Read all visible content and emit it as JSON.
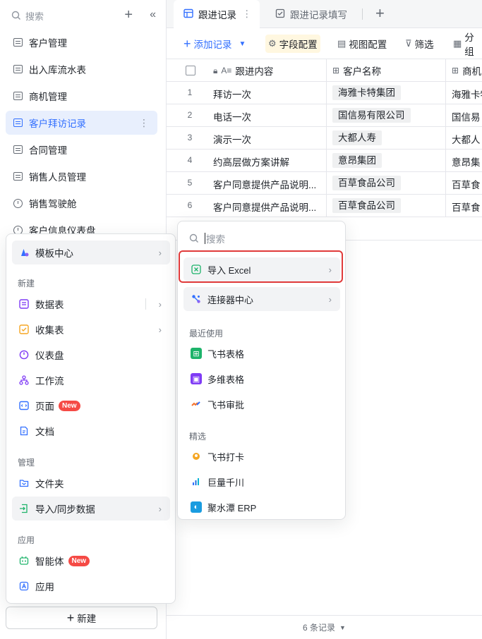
{
  "sidebar": {
    "search_placeholder": "搜索",
    "items": [
      {
        "label": "客户管理",
        "icon": "table-icon"
      },
      {
        "label": "出入库流水表",
        "icon": "table-icon"
      },
      {
        "label": "商机管理",
        "icon": "table-icon"
      },
      {
        "label": "客户拜访记录",
        "icon": "table-icon",
        "active": true
      },
      {
        "label": "合同管理",
        "icon": "table-icon"
      },
      {
        "label": "销售人员管理",
        "icon": "table-icon"
      },
      {
        "label": "销售驾驶舱",
        "icon": "dashboard-icon"
      },
      {
        "label": "客户信息仪表盘",
        "icon": "dashboard-icon"
      }
    ],
    "new_button": "新建"
  },
  "tabs": [
    {
      "label": "跟进记录",
      "active": true
    },
    {
      "label": "跟进记录填写",
      "active": false
    }
  ],
  "toolbar": {
    "add_record": "添加记录",
    "field_config": "字段配置",
    "view_config": "视图配置",
    "filter": "筛选",
    "group": "分组"
  },
  "grid": {
    "columns": [
      "跟进内容",
      "客户名称",
      "商机"
    ],
    "rows": [
      {
        "num": "1",
        "content": "拜访一次",
        "customer": "海雅卡特集团",
        "opp": "海雅卡特"
      },
      {
        "num": "2",
        "content": "电话一次",
        "customer": "国信易有限公司",
        "opp": "国信易"
      },
      {
        "num": "3",
        "content": "演示一次",
        "customer": "大都人寿",
        "opp": "大都人"
      },
      {
        "num": "4",
        "content": "约高层做方案讲解",
        "customer": "意昂集团",
        "opp": "意昂集"
      },
      {
        "num": "5",
        "content": "客户同意提供产品说明...",
        "customer": "百草食品公司",
        "opp": "百草食"
      },
      {
        "num": "6",
        "content": "客户同意提供产品说明...",
        "customer": "百草食品公司",
        "opp": "百草食"
      }
    ],
    "record_count": "6 条记录"
  },
  "new_menu": {
    "template_center": "模板中心",
    "section_new": "新建",
    "new_items": [
      {
        "label": "数据表",
        "icon": "datatable-icon",
        "arrow": true
      },
      {
        "label": "收集表",
        "icon": "form-icon",
        "arrow": true
      },
      {
        "label": "仪表盘",
        "icon": "dashboard-icon"
      },
      {
        "label": "工作流",
        "icon": "workflow-icon"
      },
      {
        "label": "页面",
        "icon": "page-icon",
        "badge": "New"
      },
      {
        "label": "文档",
        "icon": "doc-icon"
      }
    ],
    "section_manage": "管理",
    "manage_items": [
      {
        "label": "文件夹",
        "icon": "folder-icon"
      },
      {
        "label": "导入/同步数据",
        "icon": "import-icon",
        "arrow": true
      }
    ],
    "section_apps": "应用",
    "app_items": [
      {
        "label": "智能体",
        "icon": "agent-icon",
        "badge": "New"
      },
      {
        "label": "应用",
        "icon": "app-icon"
      }
    ]
  },
  "import_menu": {
    "search_placeholder": "搜索",
    "import_excel": "导入 Excel",
    "connector_center": "连接器中心",
    "section_recent": "最近使用",
    "recent": [
      {
        "label": "飞书表格",
        "icon": "sheets-icon"
      },
      {
        "label": "多维表格",
        "icon": "base-icon"
      },
      {
        "label": "飞书审批",
        "icon": "approval-icon"
      }
    ],
    "section_featured": "精选",
    "featured": [
      {
        "label": "飞书打卡",
        "icon": "attendance-icon"
      },
      {
        "label": "巨量千川",
        "icon": "qianchuan-icon"
      },
      {
        "label": "聚水潭 ERP",
        "icon": "jushuitan-icon"
      }
    ]
  },
  "colors": {
    "accent": "#3370ff",
    "badge": "#f54a45",
    "highlight_border": "#e03a3a"
  }
}
